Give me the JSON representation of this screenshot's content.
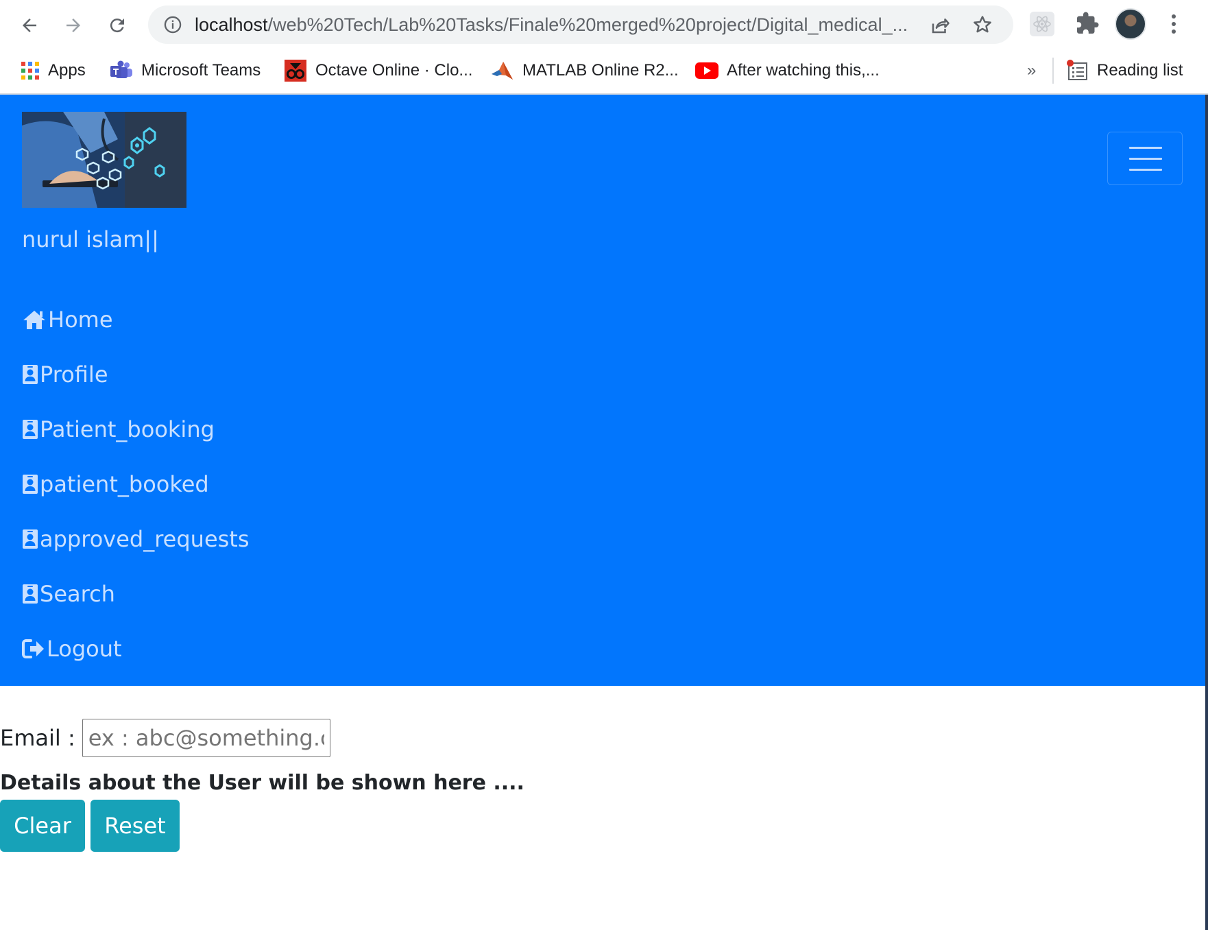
{
  "browser": {
    "url_host": "localhost",
    "url_path": "/web%20Tech/Lab%20Tasks/Finale%20merged%20project/Digital_medical_...",
    "bookmarks": [
      {
        "label": "Apps",
        "icon": "apps-grid-icon"
      },
      {
        "label": "Microsoft Teams",
        "icon": "teams-icon"
      },
      {
        "label": "Octave Online · Clo...",
        "icon": "octave-icon"
      },
      {
        "label": "MATLAB Online R2...",
        "icon": "matlab-icon"
      },
      {
        "label": "After watching this,...",
        "icon": "youtube-icon"
      }
    ],
    "more_label": "»",
    "reading_list": "Reading list"
  },
  "navbar": {
    "background": "#0276fd",
    "brand_name": "nurul islam||",
    "items": [
      {
        "label": "Home",
        "icon": "home-icon"
      },
      {
        "label": "Profile",
        "icon": "id-card-icon"
      },
      {
        "label": "Patient_booking",
        "icon": "id-card-icon"
      },
      {
        "label": "patient_booked",
        "icon": "id-card-icon"
      },
      {
        "label": "approved_requests",
        "icon": "id-card-icon"
      },
      {
        "label": "Search",
        "icon": "id-card-icon"
      },
      {
        "label": "Logout",
        "icon": "logout-icon"
      }
    ]
  },
  "main": {
    "email_label": "Email :",
    "email_placeholder": "ex : abc@something.com",
    "email_value": "",
    "details_text": "Details about the User will be shown here ....",
    "clear_label": "Clear",
    "reset_label": "Reset",
    "button_color": "#17a2b8"
  }
}
